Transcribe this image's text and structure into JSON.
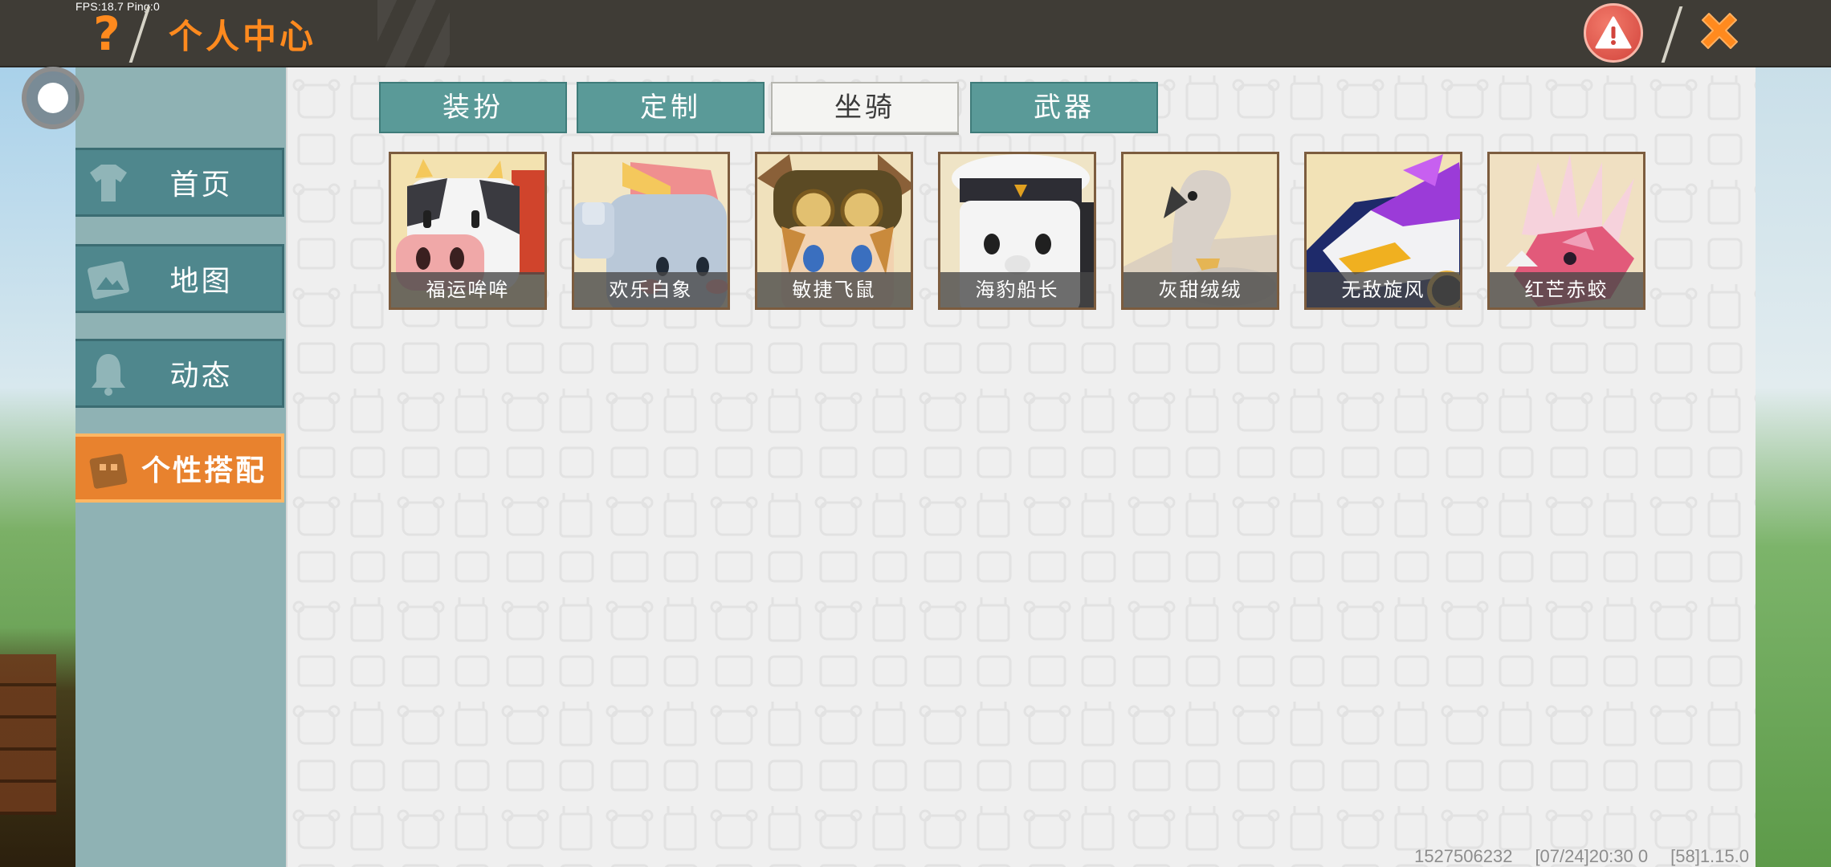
{
  "overlay": {
    "fps_text": "FPS:18.7  Ping:0"
  },
  "header": {
    "title": "个人中心",
    "help_icon": "question-icon",
    "alert_icon": "warning-icon",
    "close_icon": "close-icon"
  },
  "sidebar": {
    "items": [
      {
        "label": "首页",
        "icon": "shirt-icon",
        "active": false
      },
      {
        "label": "地图",
        "icon": "map-icon",
        "active": false
      },
      {
        "label": "动态",
        "icon": "bell-icon",
        "active": false
      },
      {
        "label": "个性搭配",
        "icon": "outfit-icon",
        "active": true
      }
    ]
  },
  "tabs": [
    {
      "label": "装扮",
      "selected": false
    },
    {
      "label": "定制",
      "selected": false
    },
    {
      "label": "坐骑",
      "selected": true
    },
    {
      "label": "武器",
      "selected": false
    }
  ],
  "mounts": [
    {
      "name": "福运哞哞"
    },
    {
      "name": "欢乐白象"
    },
    {
      "name": "敏捷飞鼠"
    },
    {
      "name": "海豹船长"
    },
    {
      "name": "灰甜绒绒"
    },
    {
      "name": "无敌旋风"
    },
    {
      "name": "红芒赤蛟"
    }
  ],
  "footer": {
    "uid": "1527506232",
    "timestamp": "[07/24]20:30 0",
    "version": "[58]1.15.0"
  },
  "colors": {
    "accent_orange": "#ff8a1e",
    "nav_teal": "#4f878d",
    "nav_active": "#e8822e",
    "tab_teal": "#5a9a98"
  }
}
